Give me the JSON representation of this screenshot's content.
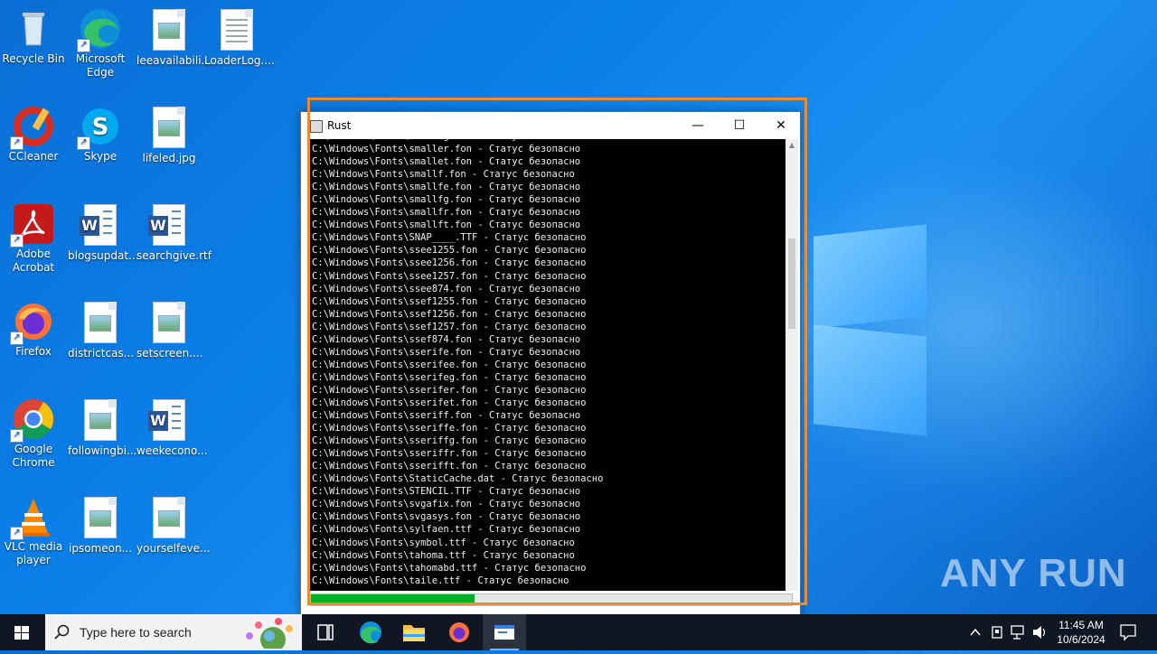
{
  "desktop": {
    "icons": [
      {
        "label": "Recycle Bin"
      },
      {
        "label": "Microsoft Edge"
      },
      {
        "label": "leeavailabili..."
      },
      {
        "label": "LoaderLog...."
      },
      {
        "label": "CCleaner"
      },
      {
        "label": "Skype"
      },
      {
        "label": "lifeled.jpg"
      },
      {
        "label": "Adobe Acrobat"
      },
      {
        "label": "blogsupdat..."
      },
      {
        "label": "searchgive.rtf"
      },
      {
        "label": "Firefox"
      },
      {
        "label": "districtcas..."
      },
      {
        "label": "setscreen...."
      },
      {
        "label": "Google Chrome"
      },
      {
        "label": "followingbi..."
      },
      {
        "label": "weekecono..."
      },
      {
        "label": "VLC media player"
      },
      {
        "label": "ipsomeon..."
      },
      {
        "label": "yourselfeve..."
      }
    ]
  },
  "window": {
    "title": "Rust",
    "minimize": "—",
    "maximize": "☐",
    "close": "✕",
    "console_lines": "C:\\Windows\\Fonts\\smalleg.fon - Статус безопасно\nC:\\Windows\\Fonts\\smaller.fon - Статус безопасно\nC:\\Windows\\Fonts\\smallet.fon - Статус безопасно\nC:\\Windows\\Fonts\\smallf.fon - Статус безопасно\nC:\\Windows\\Fonts\\smallfe.fon - Статус безопасно\nC:\\Windows\\Fonts\\smallfg.fon - Статус безопасно\nC:\\Windows\\Fonts\\smallfr.fon - Статус безопасно\nC:\\Windows\\Fonts\\smallft.fon - Статус безопасно\nC:\\Windows\\Fonts\\SNAP____.TTF - Статус безопасно\nC:\\Windows\\Fonts\\ssee1255.fon - Статус безопасно\nC:\\Windows\\Fonts\\ssee1256.fon - Статус безопасно\nC:\\Windows\\Fonts\\ssee1257.fon - Статус безопасно\nC:\\Windows\\Fonts\\ssee874.fon - Статус безопасно\nC:\\Windows\\Fonts\\ssef1255.fon - Статус безопасно\nC:\\Windows\\Fonts\\ssef1256.fon - Статус безопасно\nC:\\Windows\\Fonts\\ssef1257.fon - Статус безопасно\nC:\\Windows\\Fonts\\ssef874.fon - Статус безопасно\nC:\\Windows\\Fonts\\sserife.fon - Статус безопасно\nC:\\Windows\\Fonts\\sserifee.fon - Статус безопасно\nC:\\Windows\\Fonts\\sserifeg.fon - Статус безопасно\nC:\\Windows\\Fonts\\sserifer.fon - Статус безопасно\nC:\\Windows\\Fonts\\sserifet.fon - Статус безопасно\nC:\\Windows\\Fonts\\sseriff.fon - Статус безопасно\nC:\\Windows\\Fonts\\sseriffe.fon - Статус безопасно\nC:\\Windows\\Fonts\\sseriffg.fon - Статус безопасно\nC:\\Windows\\Fonts\\sseriffr.fon - Статус безопасно\nC:\\Windows\\Fonts\\sserifft.fon - Статус безопасно\nC:\\Windows\\Fonts\\StaticCache.dat - Статус безопасно\nC:\\Windows\\Fonts\\STENCIL.TTF - Статус безопасно\nC:\\Windows\\Fonts\\svgafix.fon - Статус безопасно\nC:\\Windows\\Fonts\\svgasys.fon - Статус безопасно\nC:\\Windows\\Fonts\\sylfaen.ttf - Статус безопасно\nC:\\Windows\\Fonts\\symbol.ttf - Статус безопасно\nC:\\Windows\\Fonts\\tahoma.ttf - Статус безопасно\nC:\\Windows\\Fonts\\tahomabd.ttf - Статус безопасно\nC:\\Windows\\Fonts\\taile.ttf - Статус безопасно",
    "progress_fraction": 0.34,
    "progress_color": "#06b025"
  },
  "taskbar": {
    "search_placeholder": "Type here to search",
    "apps": [
      "task-view",
      "edge",
      "file-explorer",
      "firefox",
      "rust-app"
    ],
    "time": "11:45 AM",
    "date": "10/6/2024"
  },
  "watermark": "ANY RUN",
  "colors": {
    "accent": "#f28a2a",
    "taskbar": "#101622"
  }
}
